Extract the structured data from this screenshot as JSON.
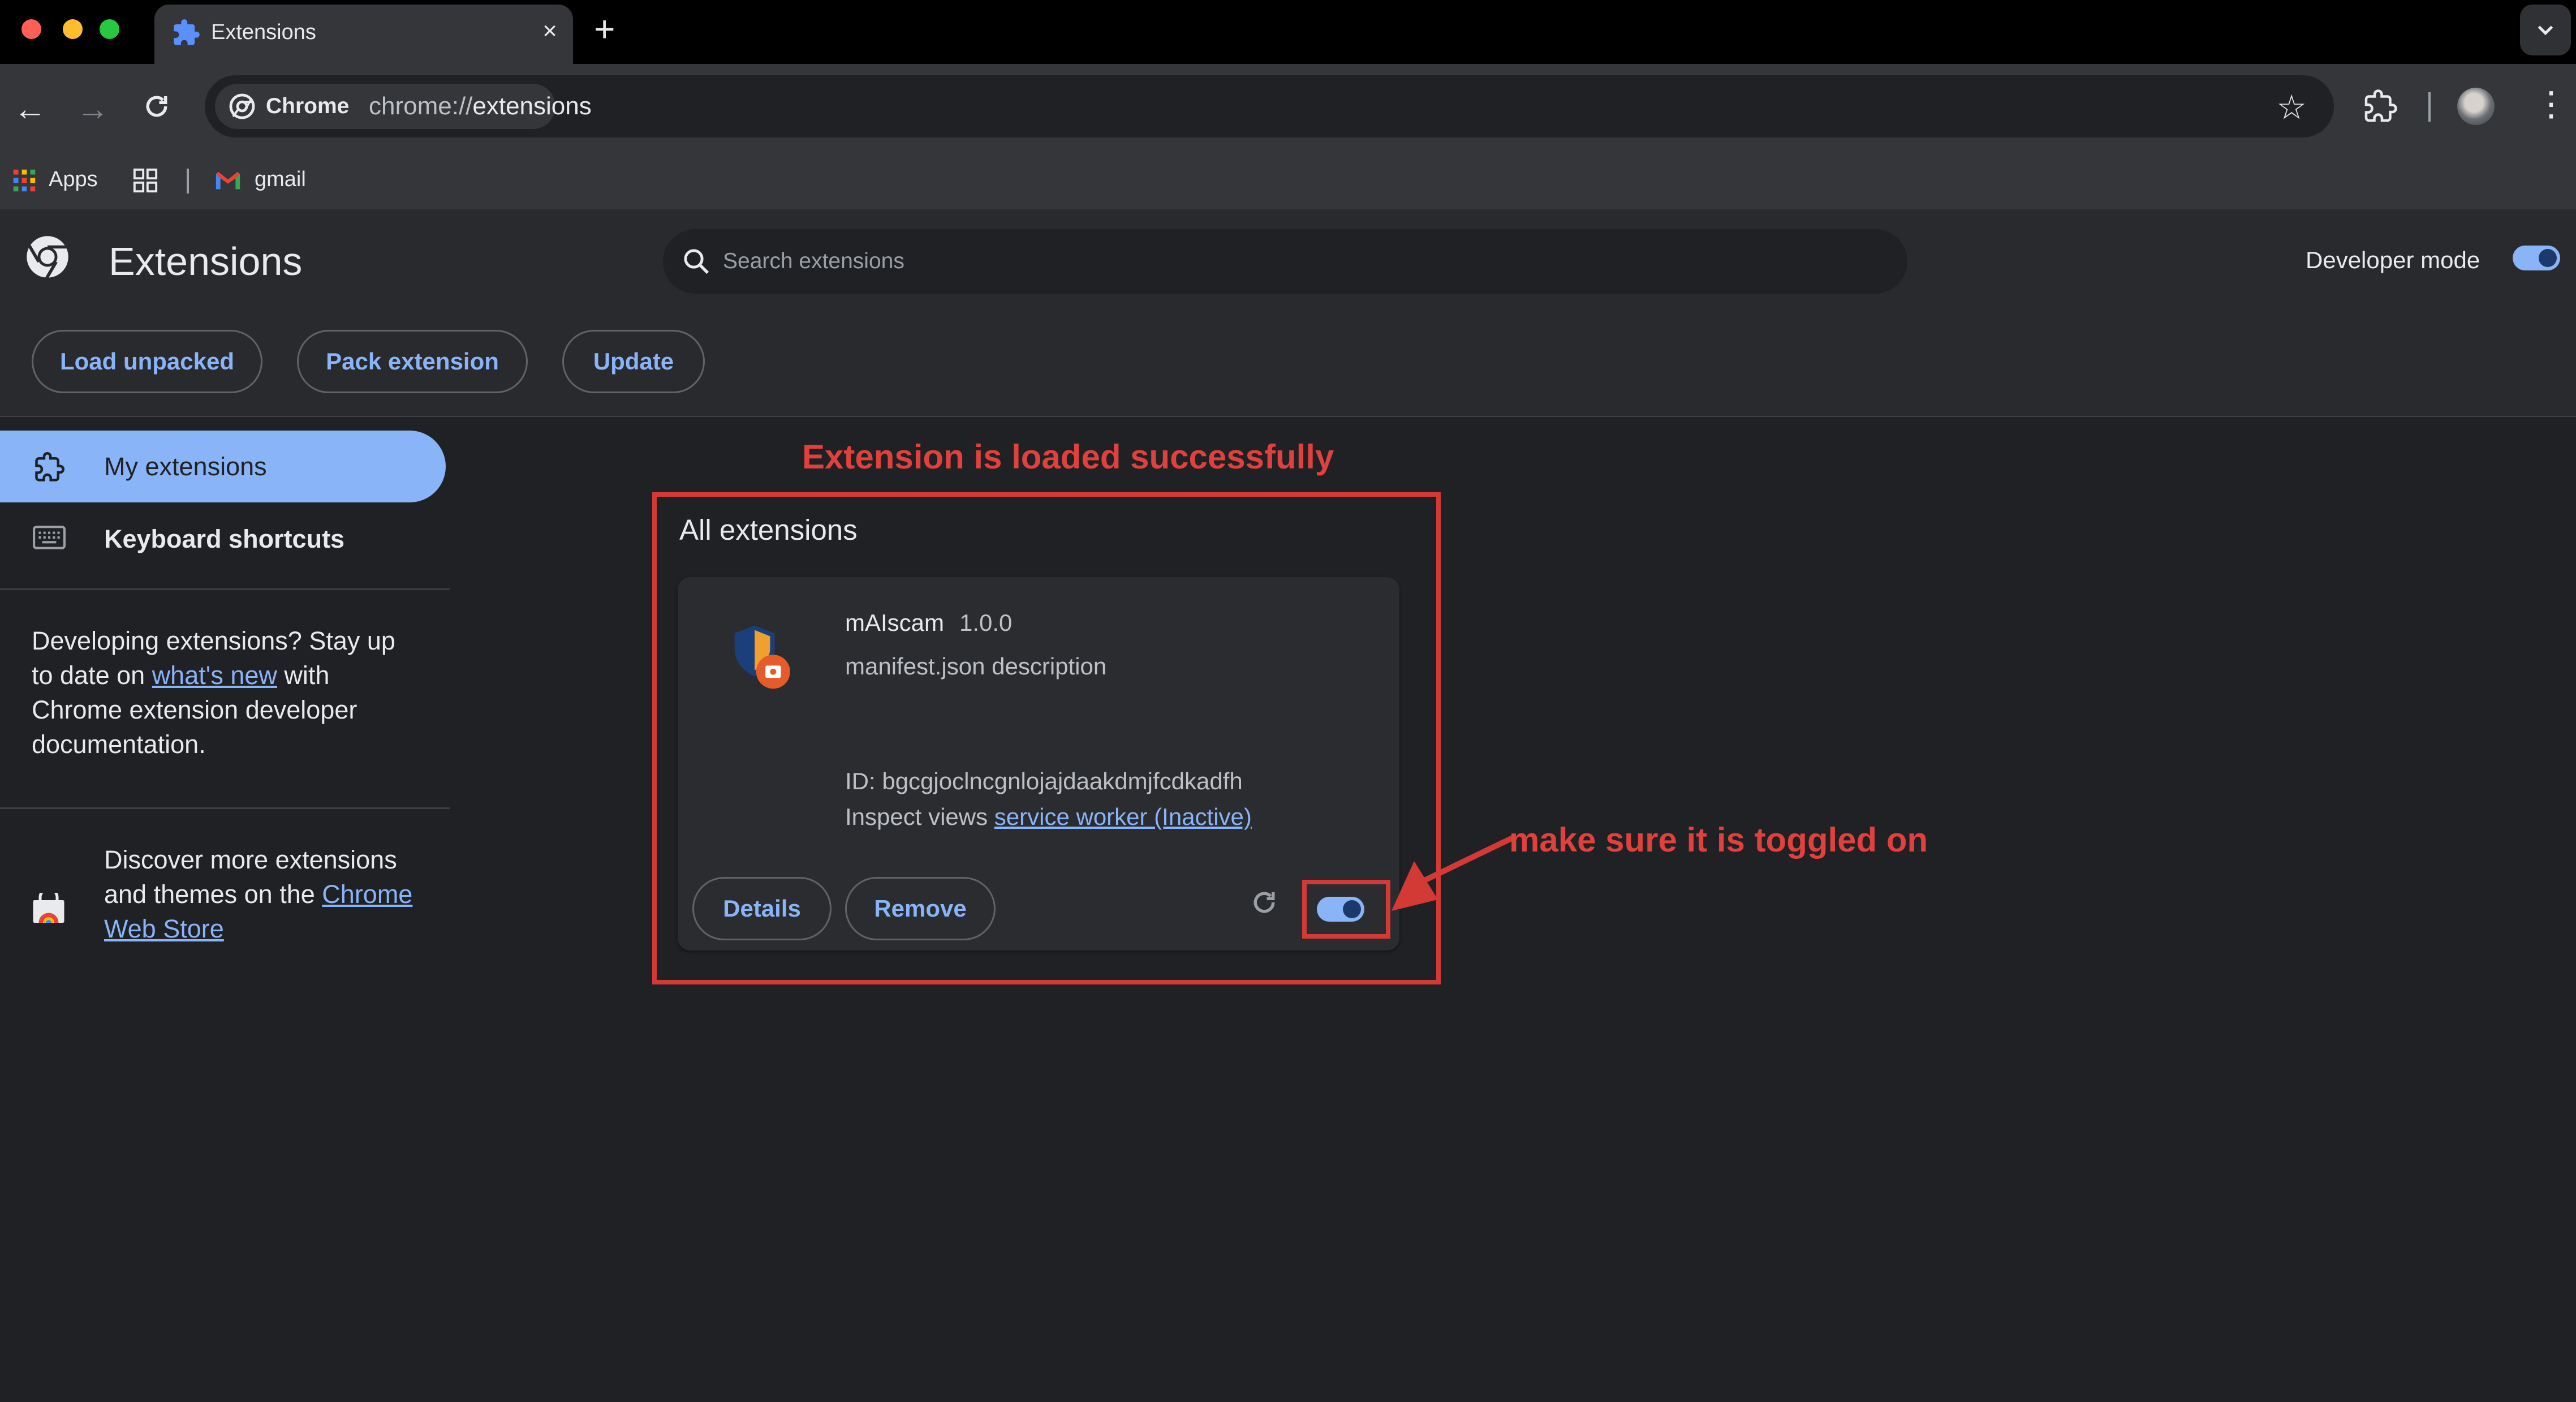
{
  "browser": {
    "tab_title": "Extensions",
    "tab_close": "×",
    "new_tab": "+",
    "omnibox_chip": "Chrome",
    "url_scheme": "chrome://",
    "url_host": "extensions",
    "bookmarks": [
      {
        "label": "Apps",
        "icon": "apps-grid-icon"
      },
      {
        "label": "",
        "icon": "tab-groups-icon"
      },
      {
        "label": "gmail",
        "icon": "gmail-icon"
      }
    ]
  },
  "header": {
    "title": "Extensions",
    "search_placeholder": "Search extensions",
    "developer_mode_label": "Developer mode",
    "developer_mode_on": true,
    "buttons": {
      "load_unpacked": "Load unpacked",
      "pack_extension": "Pack extension",
      "update": "Update"
    }
  },
  "sidebar": {
    "items": [
      {
        "label": "My extensions",
        "selected": true
      },
      {
        "label": "Keyboard shortcuts",
        "selected": false
      }
    ],
    "dev_note_pre": "Developing extensions? Stay up to date on ",
    "dev_note_link": "what's new",
    "dev_note_post": " with Chrome extension developer documentation.",
    "store_pre": "Discover more extensions and themes on the ",
    "store_link": "Chrome Web Store"
  },
  "main": {
    "annotation_top": "Extension is loaded successfully",
    "annotation_right": "make sure it is toggled on",
    "section_title": "All extensions",
    "extension": {
      "name": "mAIscam",
      "version": "1.0.0",
      "description": "manifest.json description",
      "id_text": "ID: bgcgjoclncgnlojajdaakdmjfcdkadfh",
      "inspect_label": "Inspect views ",
      "inspect_link": "service worker (Inactive)",
      "details_label": "Details",
      "remove_label": "Remove",
      "enabled": true
    }
  },
  "colors": {
    "accent": "#8ab4f8",
    "annotation_red": "#d33a36",
    "background": "#202124"
  }
}
